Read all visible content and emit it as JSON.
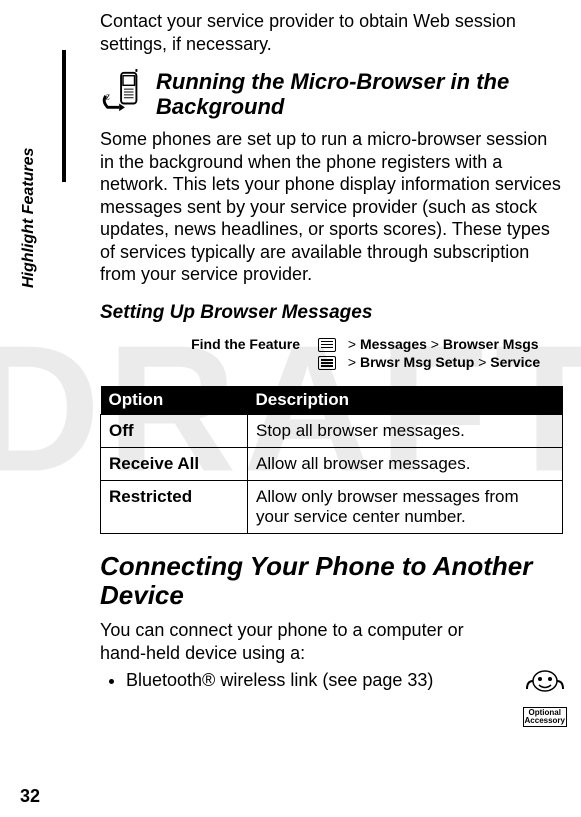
{
  "watermark": "DRAFT",
  "side_tab": "Highlight Features",
  "page_number": "32",
  "intro": "Contact your service provider to obtain Web session settings, if necessary.",
  "section_micro": {
    "heading": "Running the Micro-Browser in the Background",
    "body": "Some phones are set up to run a micro-browser session in the background when the phone registers with a network. This lets your phone display information services messages sent by your service provider (such as stock updates, news headlines, or sports scores). These types of services typically are available through subscription from your service provider."
  },
  "section_setup": {
    "heading": "Setting Up Browser Messages",
    "find_label": "Find the Feature",
    "nav1": {
      "gt1": ">",
      "item1": "Messages",
      "gt2": ">",
      "item2": "Browser Msgs"
    },
    "nav2": {
      "gt1": ">",
      "item1": "Brwsr Msg Setup",
      "gt2": ">",
      "item2": "Service"
    },
    "table": {
      "head_option": "Option",
      "head_desc": "Description",
      "rows": [
        {
          "option": "Off",
          "desc": "Stop all browser messages."
        },
        {
          "option": "Receive All",
          "desc": "Allow all browser messages."
        },
        {
          "option": "Restricted",
          "desc": "Allow only browser messages from your service center number."
        }
      ]
    }
  },
  "section_connect": {
    "heading": "Connecting Your Phone to Another Device",
    "body": "You can connect your phone to a computer or hand-held device using a:",
    "bullet1": "Bluetooth® wireless link (see page 33)",
    "accessory_label1": "Optional",
    "accessory_label2": "Accessory"
  }
}
